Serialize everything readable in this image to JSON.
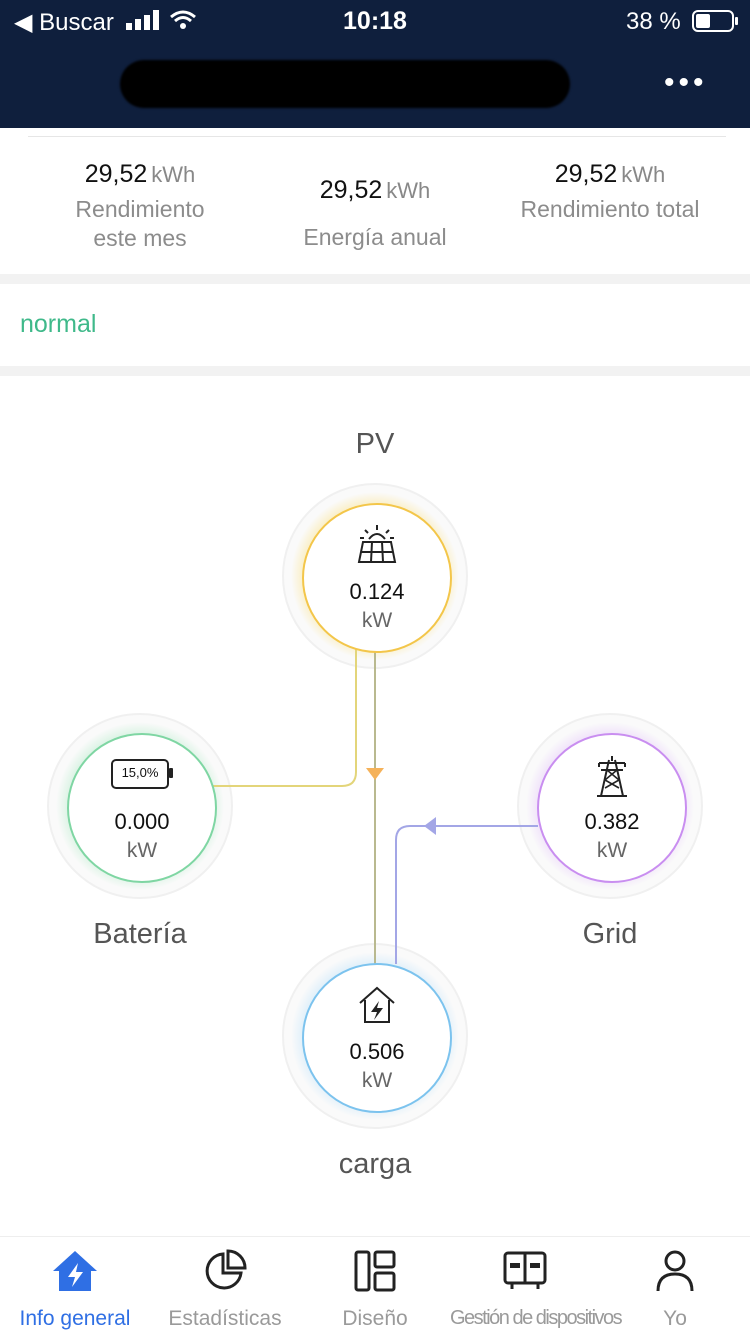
{
  "status_bar": {
    "back_label": "◀ Buscar",
    "time": "10:18",
    "battery_text": "38 %"
  },
  "nav": {
    "more_label": "•••"
  },
  "stats": [
    {
      "value": "29,52",
      "unit": "kWh",
      "label_lines": [
        "Rendimiento",
        "este mes"
      ]
    },
    {
      "value": "29,52",
      "unit": "kWh",
      "label_lines": [
        "Energía anual"
      ]
    },
    {
      "value": "29,52",
      "unit": "kWh",
      "label_lines": [
        "Rendimiento total"
      ]
    }
  ],
  "status": {
    "text": "normal",
    "color": "#3fb98a"
  },
  "flow": {
    "pv": {
      "label": "PV",
      "value": "0.124",
      "unit": "kW",
      "color": "#f3c64a",
      "icon": "solar-panel-icon"
    },
    "battery": {
      "label": "Batería",
      "value": "0.000",
      "unit": "kW",
      "color": "#7fd6a3",
      "icon": "battery-icon",
      "percent": "15,0%",
      "level": 0.15
    },
    "grid": {
      "label": "Grid",
      "value": "0.382",
      "unit": "kW",
      "color": "#c98ef0",
      "icon": "power-tower-icon"
    },
    "load": {
      "label": "carga",
      "value": "0.506",
      "unit": "kW",
      "color": "#7cc3ee",
      "icon": "house-icon"
    }
  },
  "tabs": [
    {
      "label": "Info general",
      "icon": "home-bolt-icon",
      "active": true
    },
    {
      "label": "Estadísticas",
      "icon": "pie-chart-icon",
      "active": false
    },
    {
      "label": "Diseño",
      "icon": "layout-icon",
      "active": false
    },
    {
      "label": "Gestión de dispositivos",
      "icon": "device-icon",
      "active": false
    },
    {
      "label": "Yo",
      "icon": "person-icon",
      "active": false
    }
  ],
  "accent_color": "#2f6fe4"
}
